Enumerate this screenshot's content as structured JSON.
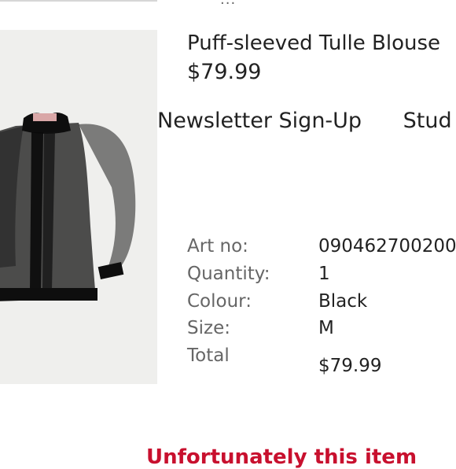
{
  "header": {
    "more_icon": "ellipsis-icon",
    "more_text": "···"
  },
  "product": {
    "image_icon": "blouse-photo",
    "title": "Puff-sleeved Tulle Blouse",
    "price": "$79.99"
  },
  "nav": {
    "items": [
      "Newsletter Sign-Up",
      "Stud"
    ]
  },
  "details": {
    "rows": [
      {
        "label": "Art no:",
        "value": "090462700200"
      },
      {
        "label": "Quantity:",
        "value": "1"
      },
      {
        "label": "Colour:",
        "value": "Black"
      },
      {
        "label": "Size:",
        "value": "M"
      },
      {
        "label": "Total",
        "value": "$79.99"
      }
    ]
  },
  "promo": {
    "text": "Unfortunately this item"
  },
  "colors": {
    "accent": "#c8102e",
    "image_bg": "#efefed",
    "garment": "#151515"
  }
}
